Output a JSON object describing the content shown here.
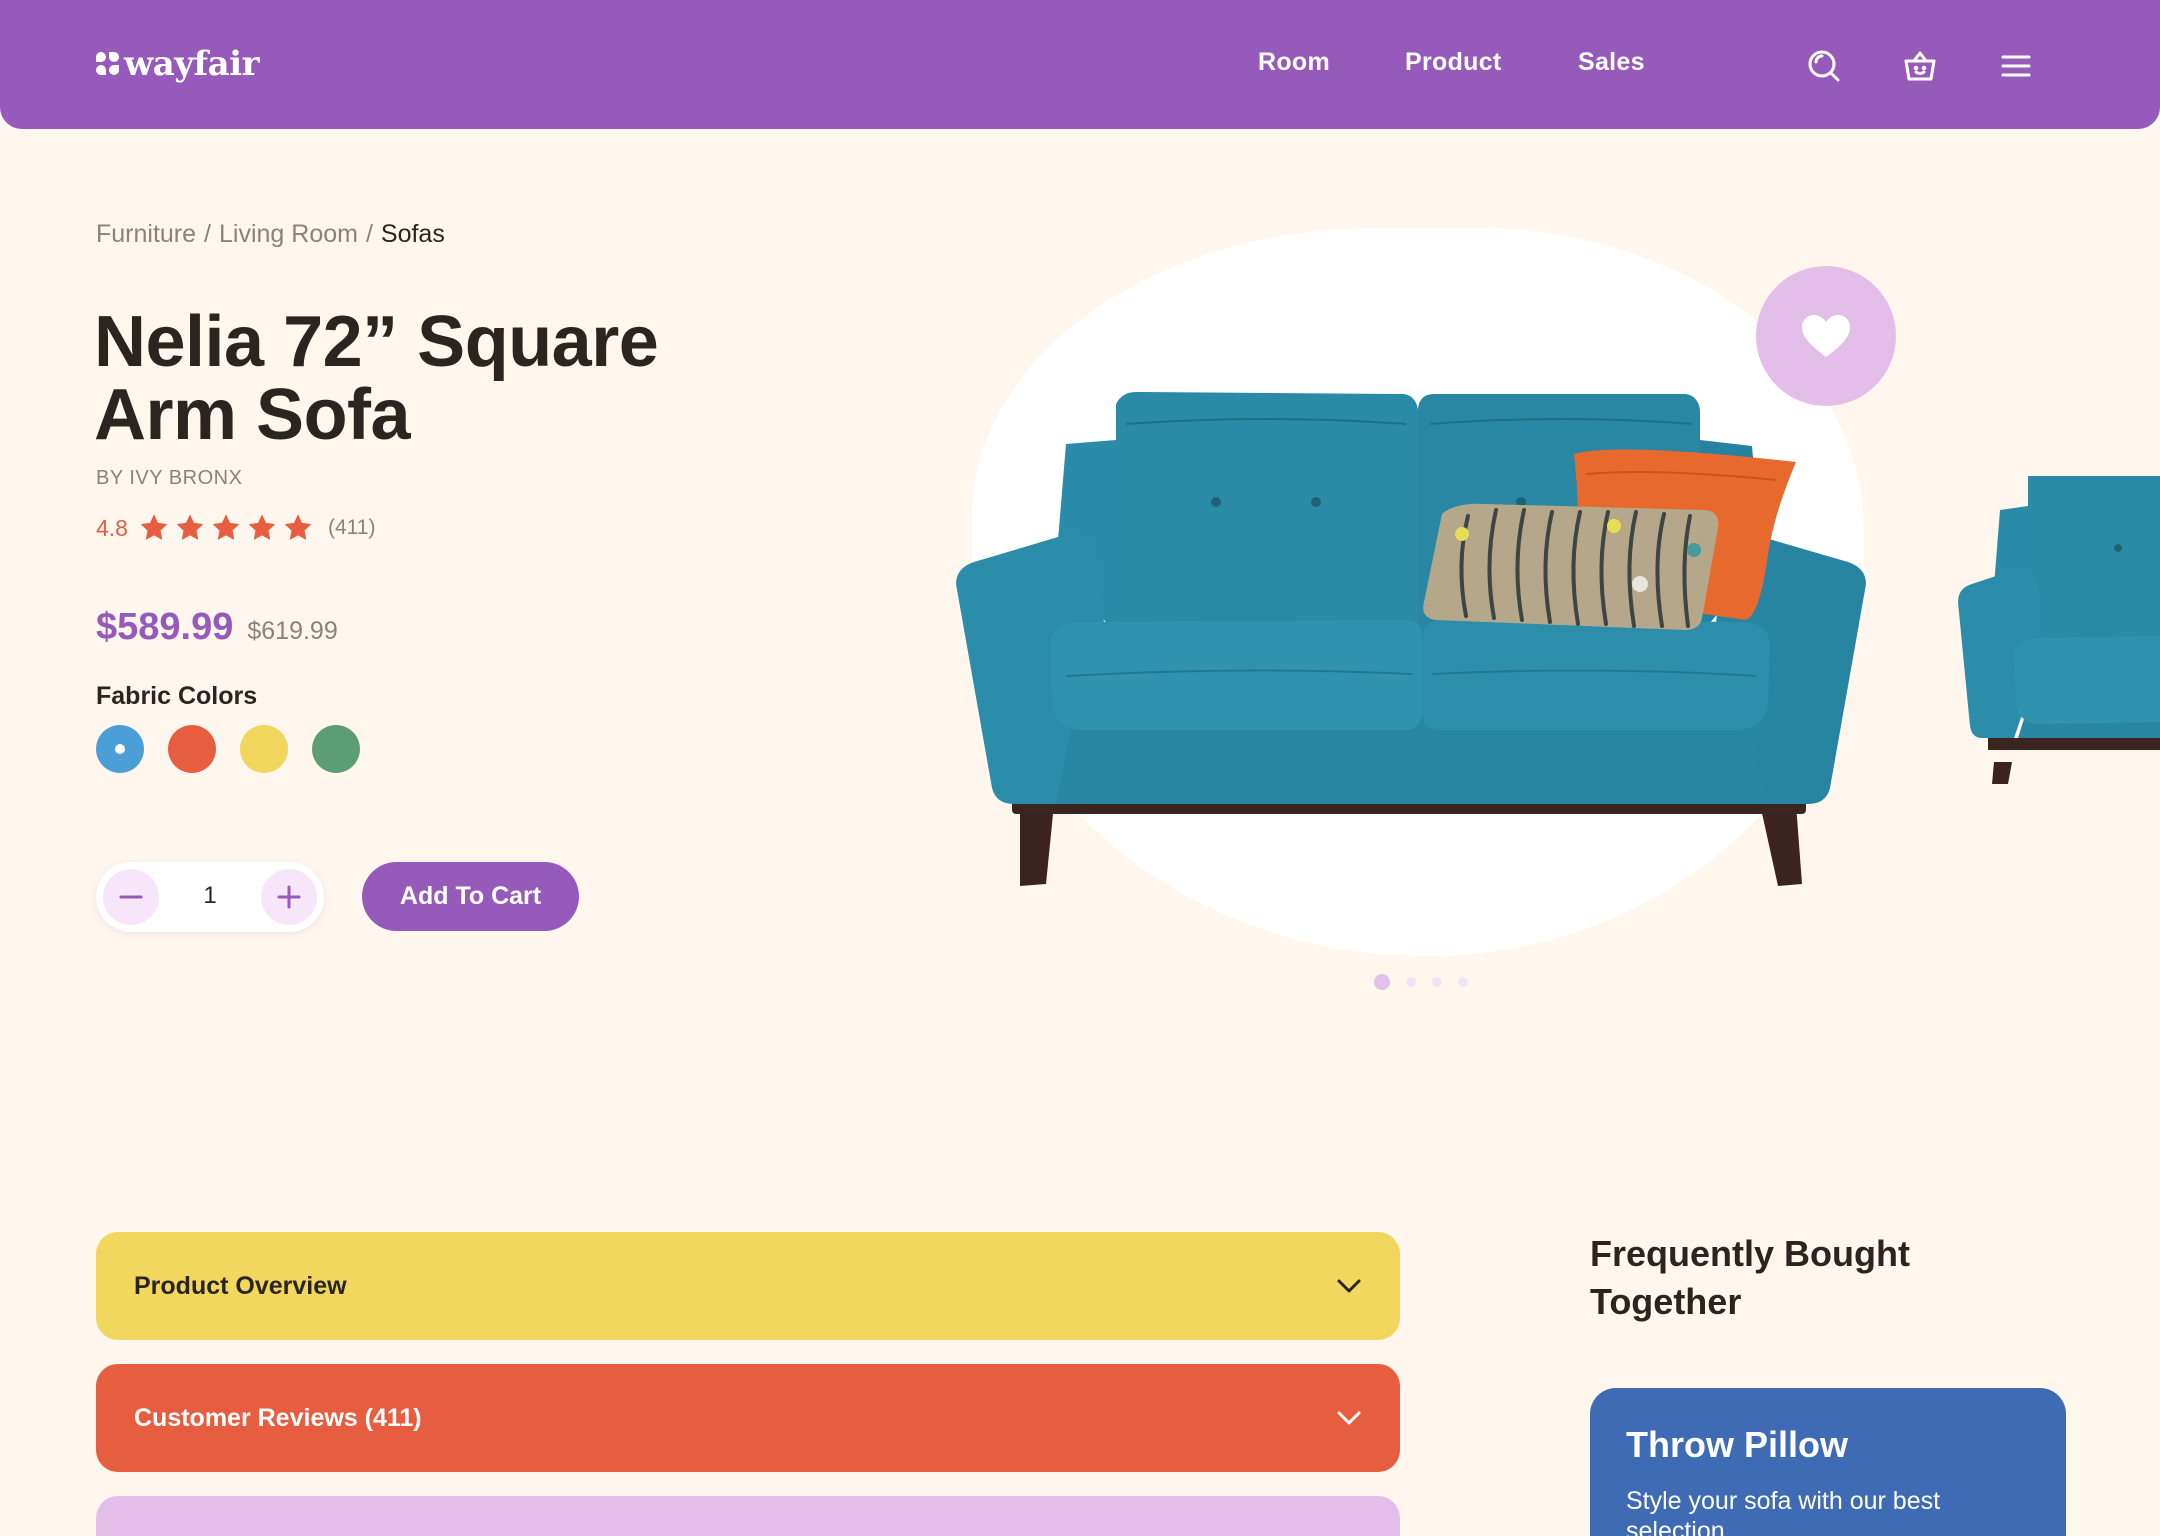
{
  "header": {
    "brand": "wayfair",
    "nav": [
      "Room",
      "Product",
      "Sales"
    ],
    "icons": [
      "search-icon",
      "basket-icon",
      "menu-icon"
    ],
    "background": "#965ABB"
  },
  "breadcrumb": {
    "items": [
      "Furniture",
      "Living Room",
      "Sofas"
    ],
    "separator": "/"
  },
  "product": {
    "title": "Nelia 72” Square Arm Sofa",
    "brand": "BY IVY BRONX",
    "rating": "4.8",
    "stars": 5,
    "reviews_count": "(411)",
    "price": "$589.99",
    "original_price": "$619.99",
    "colors_label": "Fabric Colors",
    "colors": [
      "#4B9FD6",
      "#E65D3F",
      "#F1D75E",
      "#5C9E72"
    ],
    "selected_color_index": 0,
    "quantity": "1",
    "add_to_cart": "Add To Cart"
  },
  "gallery": {
    "slides": 4,
    "active_slide": 0,
    "favorite_icon": "heart-icon"
  },
  "accordions": [
    {
      "label": "Product Overview",
      "color": "#F1D75E"
    },
    {
      "label": "Customer Reviews (411)",
      "color": "#E65D3F"
    },
    {
      "label": "",
      "color": "#E2BEE8"
    }
  ],
  "frequently_bought": {
    "title": "Frequently Bought Together",
    "card": {
      "title": "Throw Pillow",
      "description": "Style your sofa with our best selection",
      "color": "#3F6BB5"
    }
  }
}
